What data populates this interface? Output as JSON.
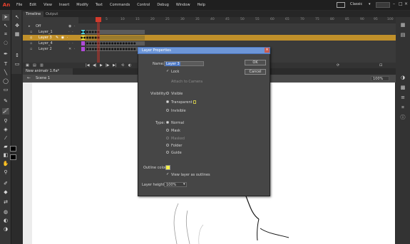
{
  "menu": {
    "logo": "An",
    "items": [
      "File",
      "Edit",
      "View",
      "Insert",
      "Modify",
      "Text",
      "Commands",
      "Control",
      "Debug",
      "Window",
      "Help"
    ],
    "workspace": "Classic"
  },
  "timeline": {
    "tabs": [
      "Timeline",
      "Output"
    ],
    "ruler_ticks": [
      "5",
      "10",
      "15",
      "20",
      "25",
      "30",
      "35",
      "40",
      "45",
      "50",
      "55",
      "60",
      "65",
      "70",
      "75",
      "80",
      "85",
      "90",
      "95",
      "100",
      "105"
    ],
    "layers": [
      {
        "name": "Off",
        "selected": false
      },
      {
        "name": "Layer_1",
        "selected": false
      },
      {
        "name": "Layer 3",
        "selected": true
      },
      {
        "name": "Layer_4",
        "selected": false
      },
      {
        "name": "Layer 2",
        "selected": false
      }
    ]
  },
  "document": {
    "tab_label": "New animatr 1.fla*",
    "scene_label": "Scene 1",
    "zoom": "100%"
  },
  "dialog": {
    "title": "Layer Properties",
    "name_label": "Name:",
    "name_value": "Layer 3",
    "ok_label": "OK",
    "cancel_label": "Cancel",
    "lock_label": "Lock",
    "attach_label": "Attach to Camera",
    "visibility_label": "Visibility:",
    "visibility_options": [
      "Visible",
      "Transparent",
      "Invisible"
    ],
    "type_label": "Type:",
    "type_options": [
      "Normal",
      "Mask",
      "Masked",
      "Folder",
      "Guide"
    ],
    "outline_label": "Outline color:",
    "outline_color": "#f5f14b",
    "view_outline_label": "View layer as outlines",
    "height_label": "Layer height:",
    "height_value": "100%"
  }
}
